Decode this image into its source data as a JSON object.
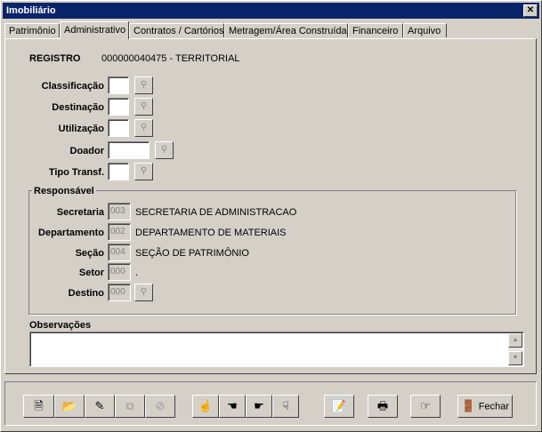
{
  "window": {
    "title": "Imobiliário",
    "close_glyph": "✕"
  },
  "tabs": [
    {
      "label": "Patrimônio",
      "active": false
    },
    {
      "label": "Administrativo",
      "active": true
    },
    {
      "label": "Contratos / Cartórios",
      "active": false
    },
    {
      "label": "Metragem/Área Construída",
      "active": false
    },
    {
      "label": "Financeiro",
      "active": false
    },
    {
      "label": "Arquivo",
      "active": false
    }
  ],
  "registro": {
    "label": "REGISTRO",
    "value": "000000040475 - TERRITORIAL"
  },
  "fields": {
    "classificacao": {
      "label": "Classificação",
      "value": ""
    },
    "destinacao": {
      "label": "Destinação",
      "value": ""
    },
    "utilizacao": {
      "label": "Utilização",
      "value": ""
    },
    "doador": {
      "label": "Doador",
      "value": ""
    },
    "tipo_transf": {
      "label": "Tipo Transf.",
      "value": ""
    }
  },
  "responsavel": {
    "label": "Responsável",
    "secretaria": {
      "label": "Secretaria",
      "code": "003",
      "name": "SECRETARIA DE ADMINISTRACAO"
    },
    "departamento": {
      "label": "Departamento",
      "code": "002",
      "name": "DEPARTAMENTO DE MATERIAIS"
    },
    "secao": {
      "label": "Seção",
      "code": "004",
      "name": "SEÇÃO DE PATRIMÔNIO"
    },
    "setor": {
      "label": "Setor",
      "code": "000",
      "name": "."
    },
    "destino": {
      "label": "Destino",
      "code": "000"
    }
  },
  "observacoes": {
    "label": "Observações",
    "value": ""
  },
  "toolbar": {
    "fechar_label": "Fechar",
    "icons": [
      "new-record-icon",
      "open-folder-icon",
      "edit-icon",
      "copy-icon",
      "cancel-icon",
      "first-record-icon",
      "previous-record-icon",
      "next-record-icon",
      "last-record-icon",
      "notes-icon",
      "print-icon",
      "details-icon",
      "close-door-icon"
    ]
  },
  "colors": {
    "titlebar": "#0a246a",
    "face": "#d4d0c8"
  }
}
